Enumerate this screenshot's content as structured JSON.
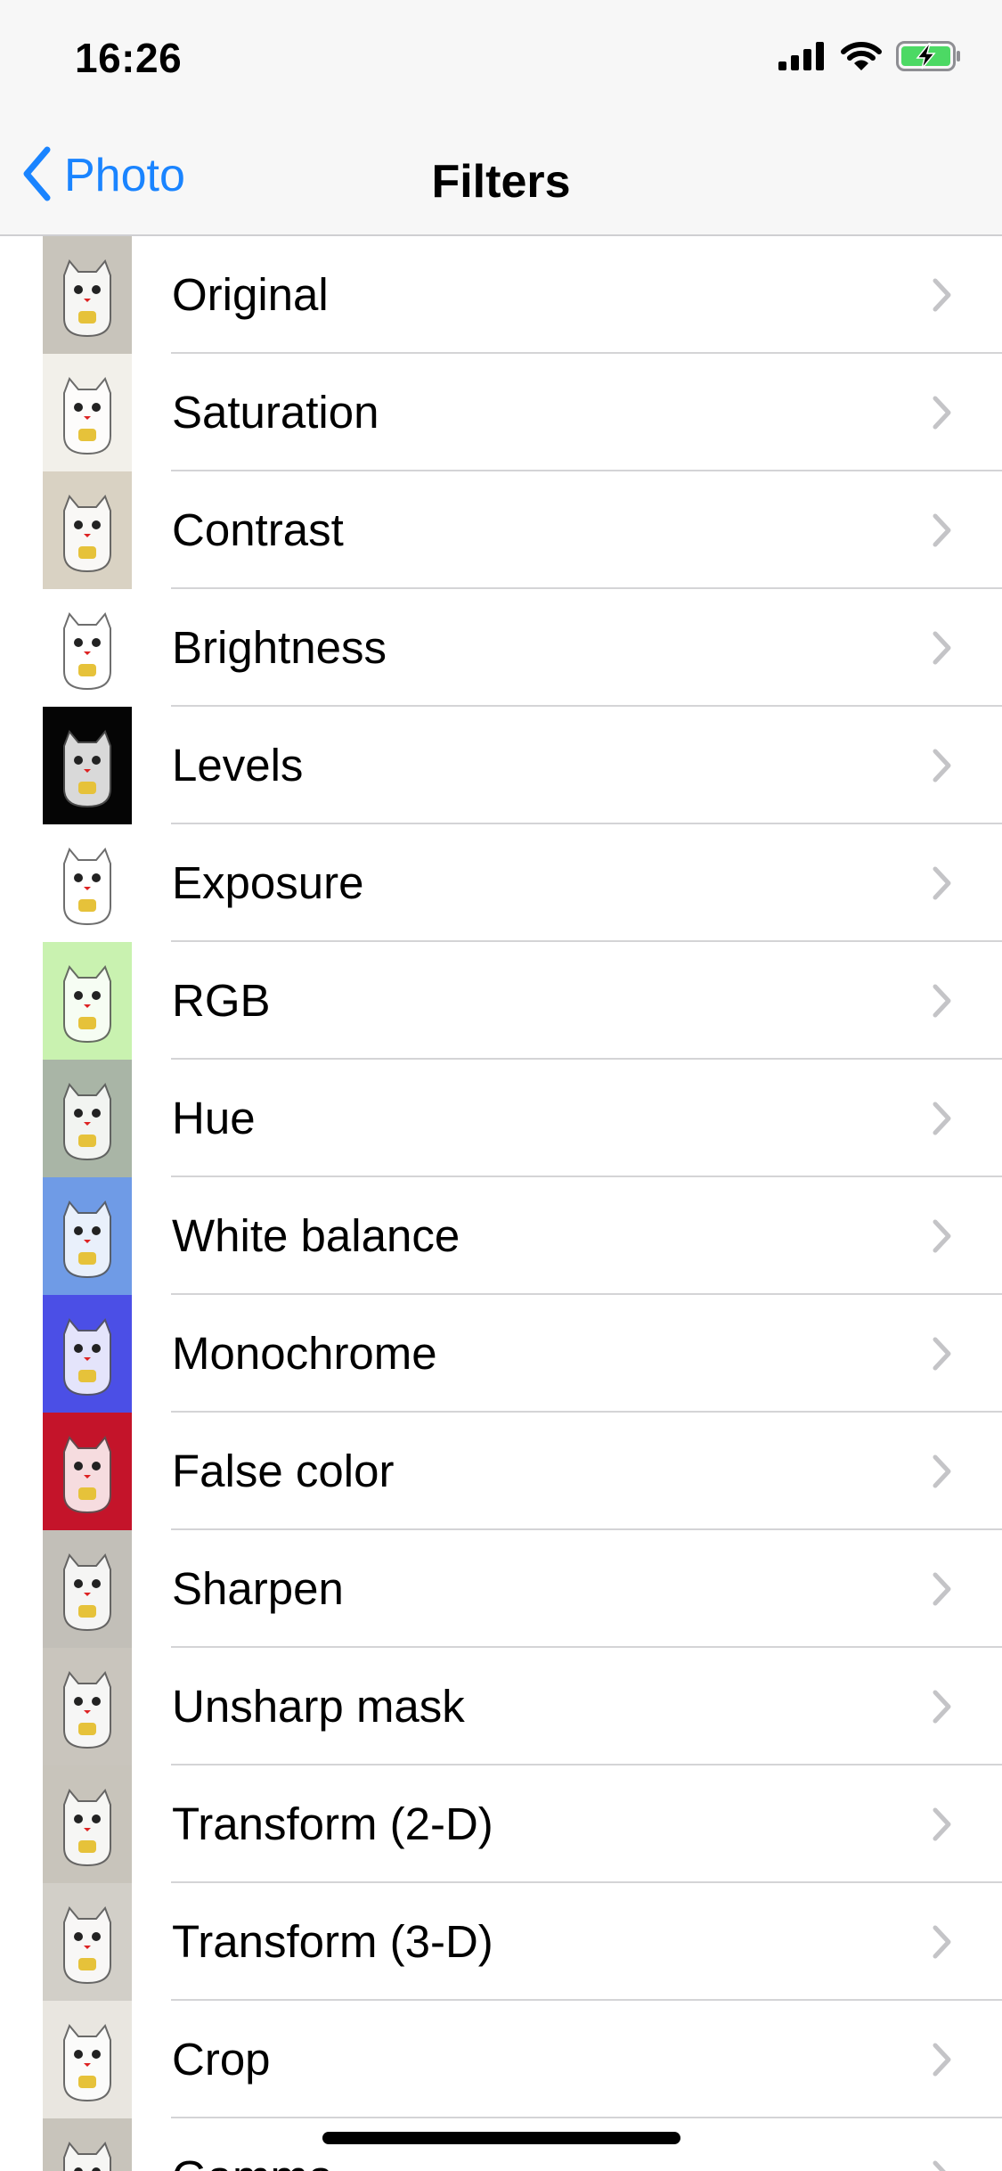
{
  "status": {
    "time": "16:26",
    "icons": [
      "signal-icon",
      "wifi-icon",
      "battery-charging-icon"
    ]
  },
  "nav": {
    "back_label": "Photo",
    "title": "Filters",
    "accent": "#1a84ff"
  },
  "filters": [
    {
      "label": "Original",
      "tint": "#c8c4bb"
    },
    {
      "label": "Saturation",
      "tint": "#f2f0ea"
    },
    {
      "label": "Contrast",
      "tint": "#d9d2c3"
    },
    {
      "label": "Brightness",
      "tint": "#ffffff"
    },
    {
      "label": "Levels",
      "tint": "#050505"
    },
    {
      "label": "Exposure",
      "tint": "#ffffff"
    },
    {
      "label": "RGB",
      "tint": "#c9f2b0"
    },
    {
      "label": "Hue",
      "tint": "#a9b5a6"
    },
    {
      "label": "White balance",
      "tint": "#6f9be6"
    },
    {
      "label": "Monochrome",
      "tint": "#4b4fe6"
    },
    {
      "label": "False color",
      "tint": "#c4142a"
    },
    {
      "label": "Sharpen",
      "tint": "#c2bfb8"
    },
    {
      "label": "Unsharp mask",
      "tint": "#c9c5bd"
    },
    {
      "label": "Transform (2-D)",
      "tint": "#c8c4bb"
    },
    {
      "label": "Transform (3-D)",
      "tint": "#d2cfc8"
    },
    {
      "label": "Crop",
      "tint": "#e9e6e0"
    },
    {
      "label": "Gamma",
      "tint": "#c8c4bb"
    }
  ]
}
